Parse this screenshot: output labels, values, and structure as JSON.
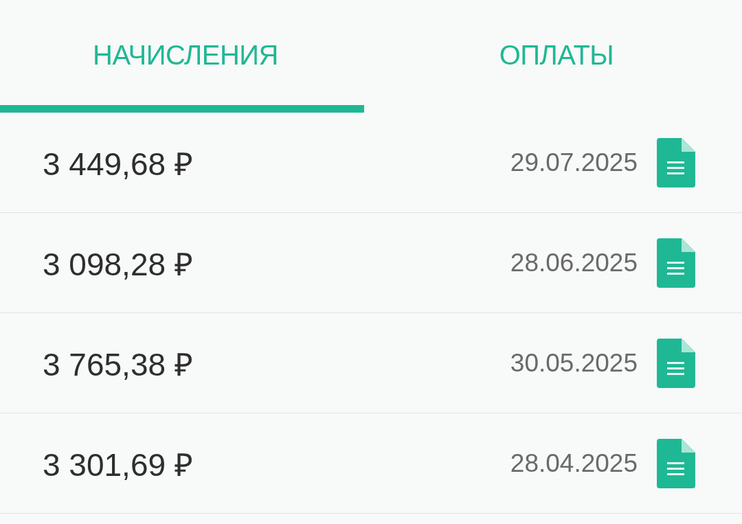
{
  "tabs": [
    {
      "label": "НАЧИСЛЕНИЯ",
      "selected": true
    },
    {
      "label": "ОПЛАТЫ",
      "selected": false
    }
  ],
  "rows": [
    {
      "amount": "3 449,68 ₽",
      "date": "29.07.2025"
    },
    {
      "amount": "3 098,28 ₽",
      "date": "28.06.2025"
    },
    {
      "amount": "3 765,38 ₽",
      "date": "30.05.2025"
    },
    {
      "amount": "3 301,69 ₽",
      "date": "28.04.2025"
    }
  ]
}
